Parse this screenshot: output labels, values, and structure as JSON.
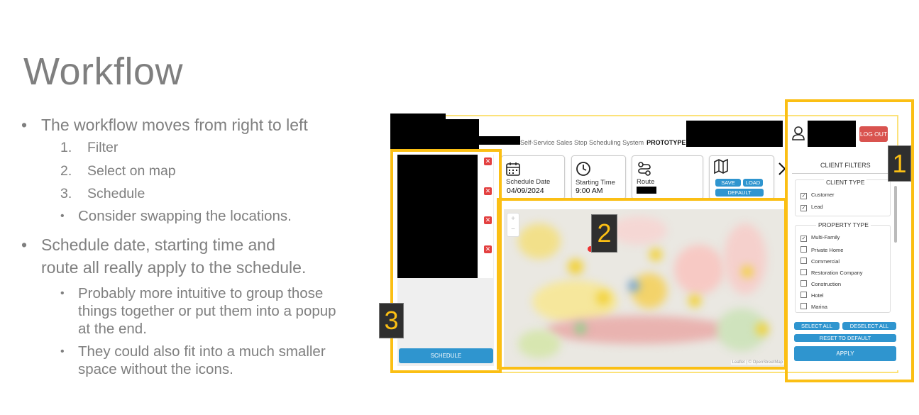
{
  "slide": {
    "title": "Workflow",
    "bullet1": "The workflow moves from right to left",
    "steps": [
      {
        "n": "1.",
        "text": "Filter"
      },
      {
        "n": "2.",
        "text": "Select on map"
      },
      {
        "n": "3.",
        "text": "Schedule"
      }
    ],
    "sub1": "Consider swapping the locations.",
    "bullet2_line1": "Schedule date, starting time and",
    "bullet2_line2": "route all really apply to the schedule.",
    "sub2_line1": "Probably more intuitive to group those",
    "sub2_line2": "things together or put them into a popup",
    "sub2_line3": "at the end.",
    "sub3_line1": "They could also fit into a much smaller",
    "sub3_line2": "space without the icons."
  },
  "prototype": {
    "system_name": "Self-Service Sales Stop Scheduling System",
    "prototype_label": "PROTOTYPE",
    "logout_label": "LOG OUT",
    "schedule_date_label": "Schedule Date",
    "schedule_date_value": "04/09/2024",
    "starting_time_label": "Starting Time",
    "starting_time_value": "9:00 AM",
    "route_label": "Route",
    "save_label": "SAVE",
    "load_label": "LOAD",
    "default_label": "DEFAULT",
    "schedule_button": "SCHEDULE",
    "map_attribution": "Leaflet | © OpenStreetMap",
    "zoom_in": "+",
    "zoom_out": "−",
    "badges": {
      "one": "1",
      "two": "2",
      "three": "3"
    },
    "filters": {
      "title": "CLIENT FILTERS",
      "client_type_heading": "CLIENT TYPE",
      "client_types": [
        {
          "label": "Customer",
          "checked": true
        },
        {
          "label": "Lead",
          "checked": true
        }
      ],
      "property_type_heading": "PROPERTY TYPE",
      "property_types": [
        {
          "label": "Multi-Family",
          "checked": true
        },
        {
          "label": "Private Home",
          "checked": false
        },
        {
          "label": "Commercial",
          "checked": false
        },
        {
          "label": "Restoration Company",
          "checked": false
        },
        {
          "label": "Construction",
          "checked": false
        },
        {
          "label": "Hotel",
          "checked": false
        },
        {
          "label": "Marina",
          "checked": false
        }
      ],
      "select_all": "SELECT ALL",
      "deselect_all": "DESELECT ALL",
      "reset_to_default": "RESET TO DEFAULT",
      "apply": "APPLY"
    }
  },
  "colors": {
    "highlight": "#fbbf14",
    "button_blue": "#2f95cf",
    "logout_red": "#d9534f",
    "text_gray": "#7f7f7f"
  }
}
